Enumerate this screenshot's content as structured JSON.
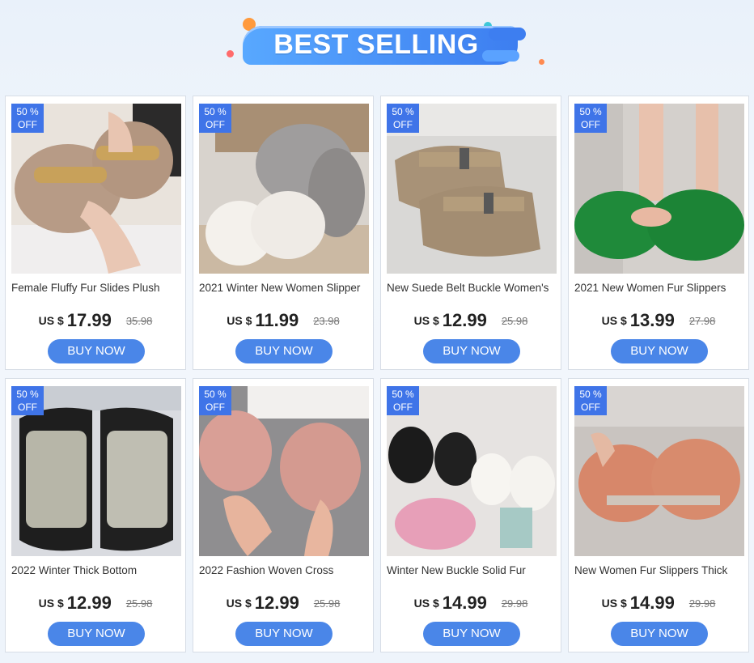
{
  "banner": {
    "title": "BEST SELLING"
  },
  "colors": {
    "accent": "#4a86e8",
    "badge": "#3f74e8"
  },
  "products": [
    {
      "name": "Female Fluffy Fur Slides Plush",
      "badge_top": "50 %",
      "badge_bottom": "OFF",
      "currency": "US $",
      "price": "17.99",
      "old_price": "35.98",
      "button": "BUY NOW",
      "image": "slipper-beige-chain-photo"
    },
    {
      "name": "2021 Winter New Women Slipper",
      "badge_top": "50 %",
      "badge_bottom": "OFF",
      "currency": "US $",
      "price": "11.99",
      "old_price": "23.98",
      "button": "BUY NOW",
      "image": "slipper-grey-white-cross-photo"
    },
    {
      "name": "New Suede Belt Buckle Women's",
      "badge_top": "50 %",
      "badge_bottom": "OFF",
      "currency": "US $",
      "price": "12.99",
      "old_price": "25.98",
      "button": "BUY NOW",
      "image": "slipper-khaki-buckle-photo"
    },
    {
      "name": "2021 New Women Fur Slippers",
      "badge_top": "50 %",
      "badge_bottom": "OFF",
      "currency": "US $",
      "price": "13.99",
      "old_price": "27.98",
      "button": "BUY NOW",
      "image": "slipper-green-fur-photo"
    },
    {
      "name": "2022 Winter Thick Bottom",
      "badge_top": "50 %",
      "badge_bottom": "OFF",
      "currency": "US $",
      "price": "12.99",
      "old_price": "25.98",
      "button": "BUY NOW",
      "image": "slipper-silver-puffer-photo"
    },
    {
      "name": "2022 Fashion Woven Cross",
      "badge_top": "50 %",
      "badge_bottom": "OFF",
      "currency": "US $",
      "price": "12.99",
      "old_price": "25.98",
      "button": "BUY NOW",
      "image": "slipper-pink-woven-photo"
    },
    {
      "name": "Winter New Buckle Solid Fur",
      "badge_top": "50 %",
      "badge_bottom": "OFF",
      "currency": "US $",
      "price": "14.99",
      "old_price": "29.98",
      "button": "BUY NOW",
      "image": "slipper-black-white-pink-buckle-photo"
    },
    {
      "name": "New Women Fur Slippers Thick",
      "badge_top": "50 %",
      "badge_bottom": "OFF",
      "currency": "US $",
      "price": "14.99",
      "old_price": "29.98",
      "button": "BUY NOW",
      "image": "slipper-orange-fur-photo"
    }
  ]
}
